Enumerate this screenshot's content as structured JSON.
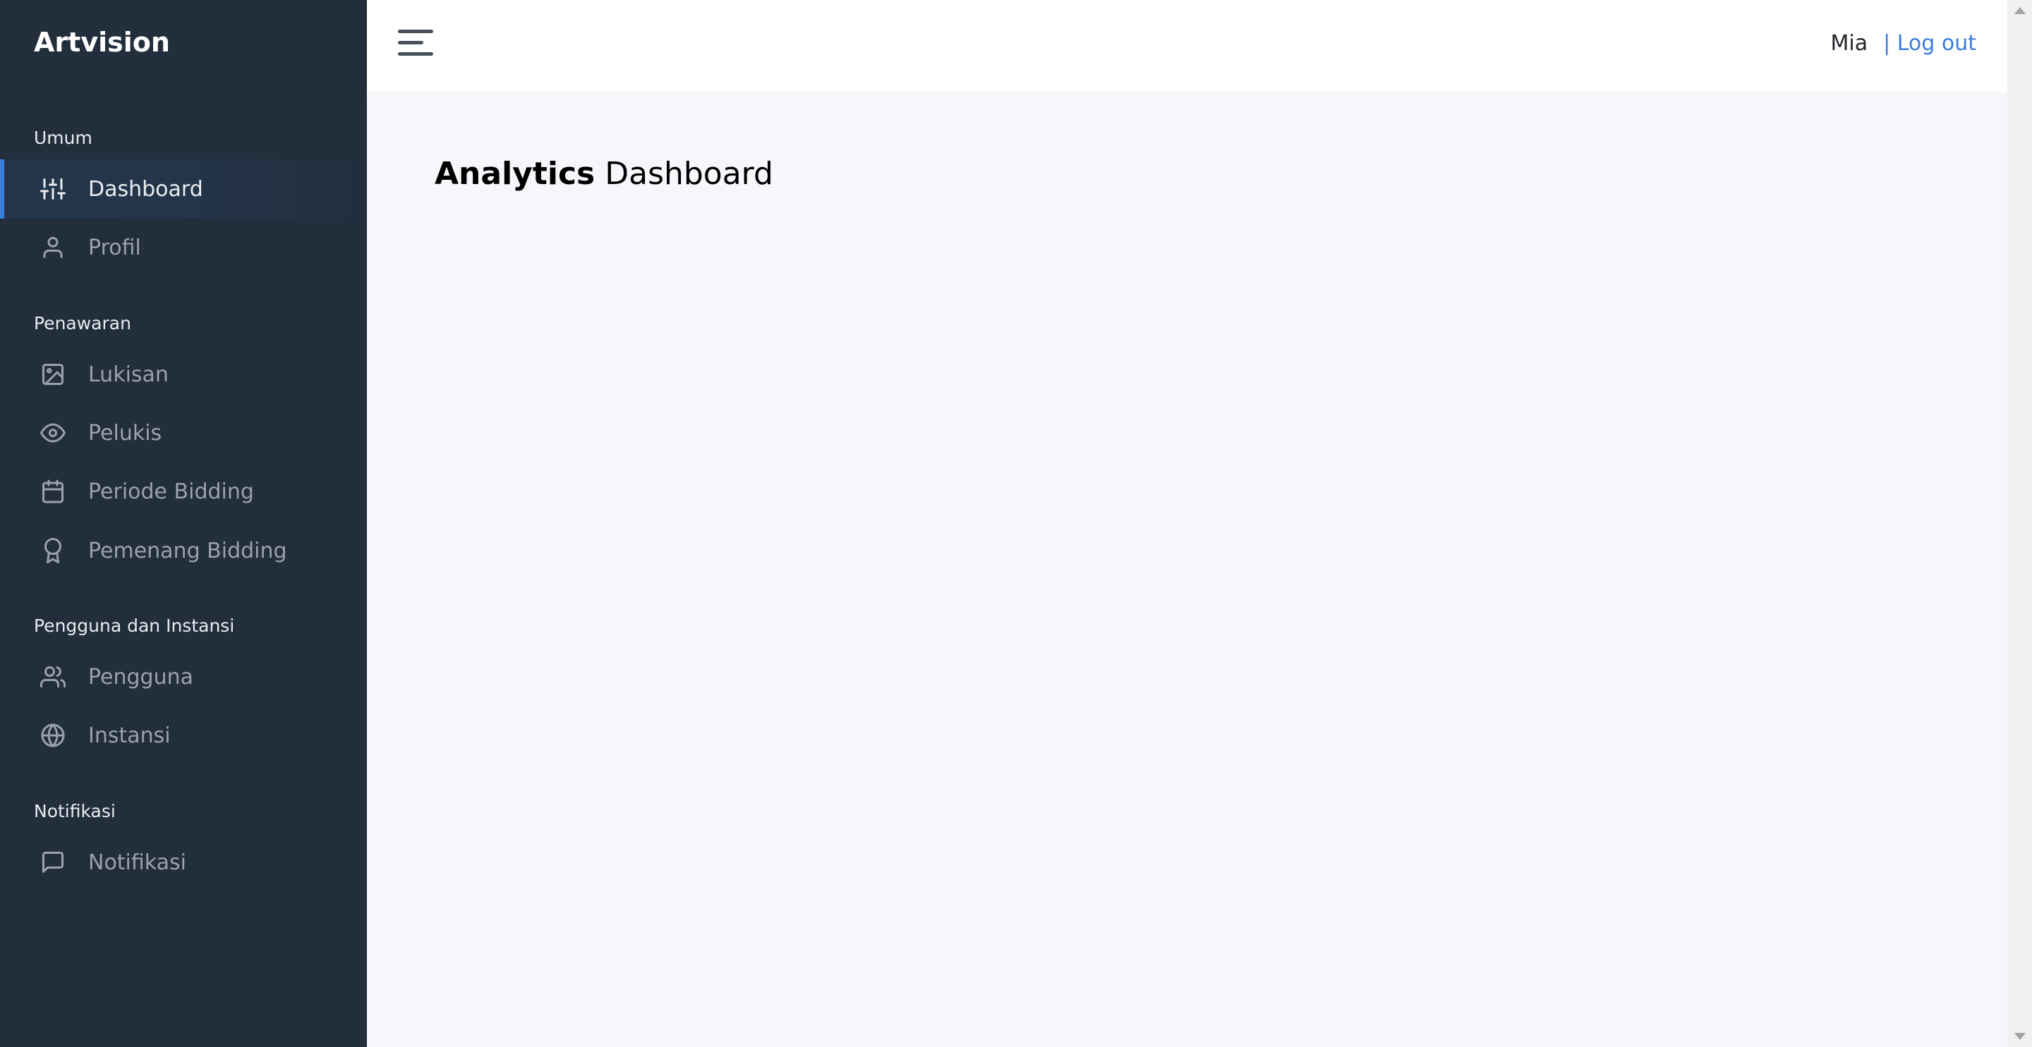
{
  "brand": {
    "name": "Artvision"
  },
  "sidebar": {
    "sections": [
      {
        "header": "Umum"
      },
      {
        "header": "Penawaran"
      },
      {
        "header": "Pengguna dan Instansi"
      },
      {
        "header": "Notifikasi"
      }
    ],
    "items": [
      {
        "label": "Dashboard",
        "icon": "sliders-icon",
        "active": true
      },
      {
        "label": "Profil",
        "icon": "user-icon",
        "active": false
      },
      {
        "label": "Lukisan",
        "icon": "image-icon",
        "active": false
      },
      {
        "label": "Pelukis",
        "icon": "eye-icon",
        "active": false
      },
      {
        "label": "Periode Bidding",
        "icon": "calendar-icon",
        "active": false
      },
      {
        "label": "Pemenang Bidding",
        "icon": "award-icon",
        "active": false
      },
      {
        "label": "Pengguna",
        "icon": "users-icon",
        "active": false
      },
      {
        "label": "Instansi",
        "icon": "globe-icon",
        "active": false
      },
      {
        "label": "Notifikasi",
        "icon": "message-square-icon",
        "active": false
      }
    ],
    "colors": {
      "background": "#222e3c",
      "active_accent": "#3b7ddd"
    }
  },
  "topbar": {
    "menu_icon": "hamburger-icon",
    "user_name": "Mia",
    "logout_label": "| Log out"
  },
  "main": {
    "title_bold": "Analytics",
    "title_rest": "Dashboard"
  }
}
